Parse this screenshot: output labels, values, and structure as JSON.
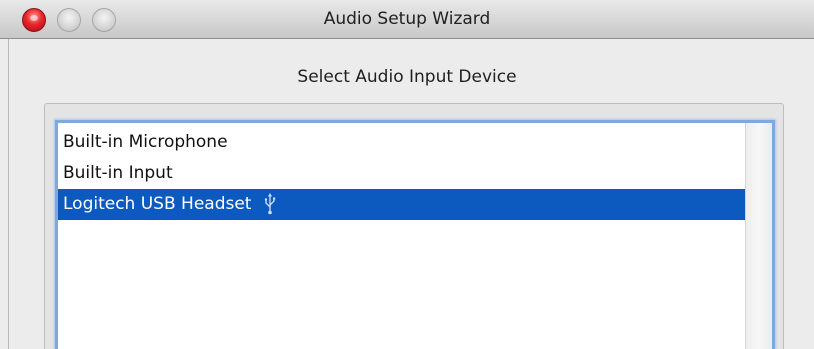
{
  "window": {
    "title": "Audio Setup Wizard"
  },
  "main": {
    "heading": "Select Audio Input Device",
    "devices": [
      {
        "label": "Built-in Microphone",
        "selected": false,
        "icon": null
      },
      {
        "label": "Built-in Input",
        "selected": false,
        "icon": null
      },
      {
        "label": "Logitech USB Headset",
        "selected": true,
        "icon": "usb-icon"
      }
    ]
  },
  "colors": {
    "selection": "#0c59bf",
    "focus_ring": "#7fa9dc",
    "close_button": "#e8252a"
  }
}
